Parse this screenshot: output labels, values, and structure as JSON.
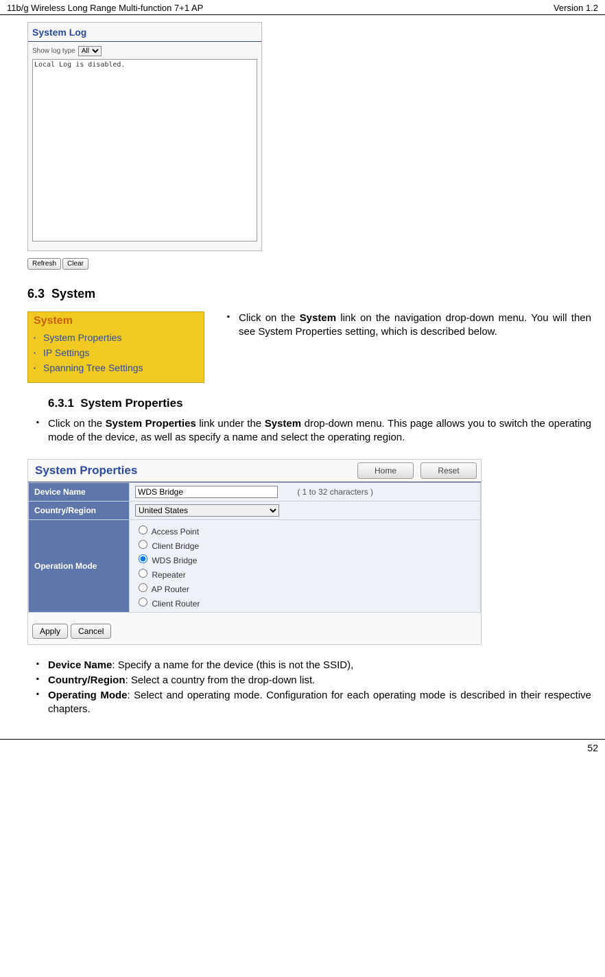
{
  "header": {
    "left": "11b/g Wireless Long Range Multi-function 7+1 AP",
    "right": "Version 1.2"
  },
  "syslog": {
    "title": "System Log",
    "show_label": "Show log type",
    "show_value": "All",
    "text": "Local Log is disabled.",
    "refresh": "Refresh",
    "clear": "Clear"
  },
  "sec63": {
    "num": "6.3",
    "title": "System"
  },
  "systemMenu": {
    "title": "System",
    "items": [
      "System Properties",
      "IP Settings",
      "Spanning Tree Settings"
    ]
  },
  "systemNote": {
    "prefix": "Click on the ",
    "bold": "System",
    "suffix": " link on the navigation drop-down menu. You will then see System Properties setting, which is described below."
  },
  "sec631": {
    "num": "6.3.1",
    "title": "System Properties"
  },
  "para631": {
    "a": "Click on the ",
    "b": "System Properties",
    "c": " link under the ",
    "d": "System",
    "e": " drop-down menu. This page allows you to switch the operating mode of the device, as well as specify a name and select the operating region."
  },
  "sysprops": {
    "title": "System Properties",
    "home": "Home",
    "reset": "Reset",
    "device_label": "Device Name",
    "device_value": "WDS Bridge",
    "chars_note": "( 1 to 32 characters )",
    "country_label": "Country/Region",
    "country_value": "United States",
    "op_label": "Operation Mode",
    "modes": [
      "Access Point",
      "Client Bridge",
      "WDS Bridge",
      "Repeater",
      "AP Router",
      "Client Router"
    ],
    "selected_mode": "WDS Bridge",
    "apply": "Apply",
    "cancel": "Cancel"
  },
  "defs": {
    "d1_bold": "Device Name",
    "d1_text": ": Specify a name for the device (this is not the SSID),",
    "d2_bold": "Country/Region",
    "d2_text": ": Select a country from the drop-down list.",
    "d3_bold": "Operating Mode",
    "d3_text": ": Select and operating mode. Configuration for each operating mode is described in their respective chapters."
  },
  "footer": {
    "page": "52"
  }
}
